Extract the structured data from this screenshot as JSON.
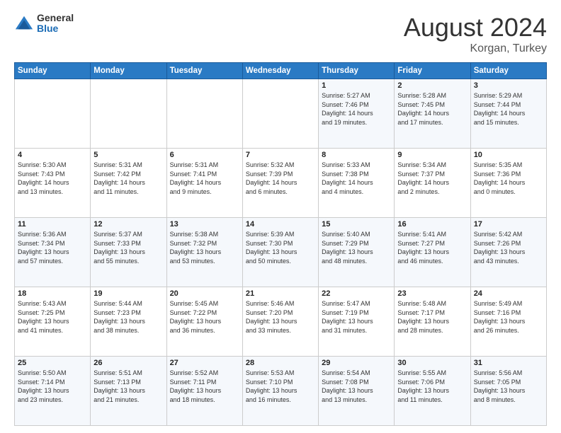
{
  "header": {
    "logo_general": "General",
    "logo_blue": "Blue",
    "month_title": "August 2024",
    "subtitle": "Korgan, Turkey"
  },
  "days_header": [
    "Sunday",
    "Monday",
    "Tuesday",
    "Wednesday",
    "Thursday",
    "Friday",
    "Saturday"
  ],
  "weeks": [
    [
      {
        "day": "",
        "content": ""
      },
      {
        "day": "",
        "content": ""
      },
      {
        "day": "",
        "content": ""
      },
      {
        "day": "",
        "content": ""
      },
      {
        "day": "1",
        "content": "Sunrise: 5:27 AM\nSunset: 7:46 PM\nDaylight: 14 hours\nand 19 minutes."
      },
      {
        "day": "2",
        "content": "Sunrise: 5:28 AM\nSunset: 7:45 PM\nDaylight: 14 hours\nand 17 minutes."
      },
      {
        "day": "3",
        "content": "Sunrise: 5:29 AM\nSunset: 7:44 PM\nDaylight: 14 hours\nand 15 minutes."
      }
    ],
    [
      {
        "day": "4",
        "content": "Sunrise: 5:30 AM\nSunset: 7:43 PM\nDaylight: 14 hours\nand 13 minutes."
      },
      {
        "day": "5",
        "content": "Sunrise: 5:31 AM\nSunset: 7:42 PM\nDaylight: 14 hours\nand 11 minutes."
      },
      {
        "day": "6",
        "content": "Sunrise: 5:31 AM\nSunset: 7:41 PM\nDaylight: 14 hours\nand 9 minutes."
      },
      {
        "day": "7",
        "content": "Sunrise: 5:32 AM\nSunset: 7:39 PM\nDaylight: 14 hours\nand 6 minutes."
      },
      {
        "day": "8",
        "content": "Sunrise: 5:33 AM\nSunset: 7:38 PM\nDaylight: 14 hours\nand 4 minutes."
      },
      {
        "day": "9",
        "content": "Sunrise: 5:34 AM\nSunset: 7:37 PM\nDaylight: 14 hours\nand 2 minutes."
      },
      {
        "day": "10",
        "content": "Sunrise: 5:35 AM\nSunset: 7:36 PM\nDaylight: 14 hours\nand 0 minutes."
      }
    ],
    [
      {
        "day": "11",
        "content": "Sunrise: 5:36 AM\nSunset: 7:34 PM\nDaylight: 13 hours\nand 57 minutes."
      },
      {
        "day": "12",
        "content": "Sunrise: 5:37 AM\nSunset: 7:33 PM\nDaylight: 13 hours\nand 55 minutes."
      },
      {
        "day": "13",
        "content": "Sunrise: 5:38 AM\nSunset: 7:32 PM\nDaylight: 13 hours\nand 53 minutes."
      },
      {
        "day": "14",
        "content": "Sunrise: 5:39 AM\nSunset: 7:30 PM\nDaylight: 13 hours\nand 50 minutes."
      },
      {
        "day": "15",
        "content": "Sunrise: 5:40 AM\nSunset: 7:29 PM\nDaylight: 13 hours\nand 48 minutes."
      },
      {
        "day": "16",
        "content": "Sunrise: 5:41 AM\nSunset: 7:27 PM\nDaylight: 13 hours\nand 46 minutes."
      },
      {
        "day": "17",
        "content": "Sunrise: 5:42 AM\nSunset: 7:26 PM\nDaylight: 13 hours\nand 43 minutes."
      }
    ],
    [
      {
        "day": "18",
        "content": "Sunrise: 5:43 AM\nSunset: 7:25 PM\nDaylight: 13 hours\nand 41 minutes."
      },
      {
        "day": "19",
        "content": "Sunrise: 5:44 AM\nSunset: 7:23 PM\nDaylight: 13 hours\nand 38 minutes."
      },
      {
        "day": "20",
        "content": "Sunrise: 5:45 AM\nSunset: 7:22 PM\nDaylight: 13 hours\nand 36 minutes."
      },
      {
        "day": "21",
        "content": "Sunrise: 5:46 AM\nSunset: 7:20 PM\nDaylight: 13 hours\nand 33 minutes."
      },
      {
        "day": "22",
        "content": "Sunrise: 5:47 AM\nSunset: 7:19 PM\nDaylight: 13 hours\nand 31 minutes."
      },
      {
        "day": "23",
        "content": "Sunrise: 5:48 AM\nSunset: 7:17 PM\nDaylight: 13 hours\nand 28 minutes."
      },
      {
        "day": "24",
        "content": "Sunrise: 5:49 AM\nSunset: 7:16 PM\nDaylight: 13 hours\nand 26 minutes."
      }
    ],
    [
      {
        "day": "25",
        "content": "Sunrise: 5:50 AM\nSunset: 7:14 PM\nDaylight: 13 hours\nand 23 minutes."
      },
      {
        "day": "26",
        "content": "Sunrise: 5:51 AM\nSunset: 7:13 PM\nDaylight: 13 hours\nand 21 minutes."
      },
      {
        "day": "27",
        "content": "Sunrise: 5:52 AM\nSunset: 7:11 PM\nDaylight: 13 hours\nand 18 minutes."
      },
      {
        "day": "28",
        "content": "Sunrise: 5:53 AM\nSunset: 7:10 PM\nDaylight: 13 hours\nand 16 minutes."
      },
      {
        "day": "29",
        "content": "Sunrise: 5:54 AM\nSunset: 7:08 PM\nDaylight: 13 hours\nand 13 minutes."
      },
      {
        "day": "30",
        "content": "Sunrise: 5:55 AM\nSunset: 7:06 PM\nDaylight: 13 hours\nand 11 minutes."
      },
      {
        "day": "31",
        "content": "Sunrise: 5:56 AM\nSunset: 7:05 PM\nDaylight: 13 hours\nand 8 minutes."
      }
    ]
  ]
}
